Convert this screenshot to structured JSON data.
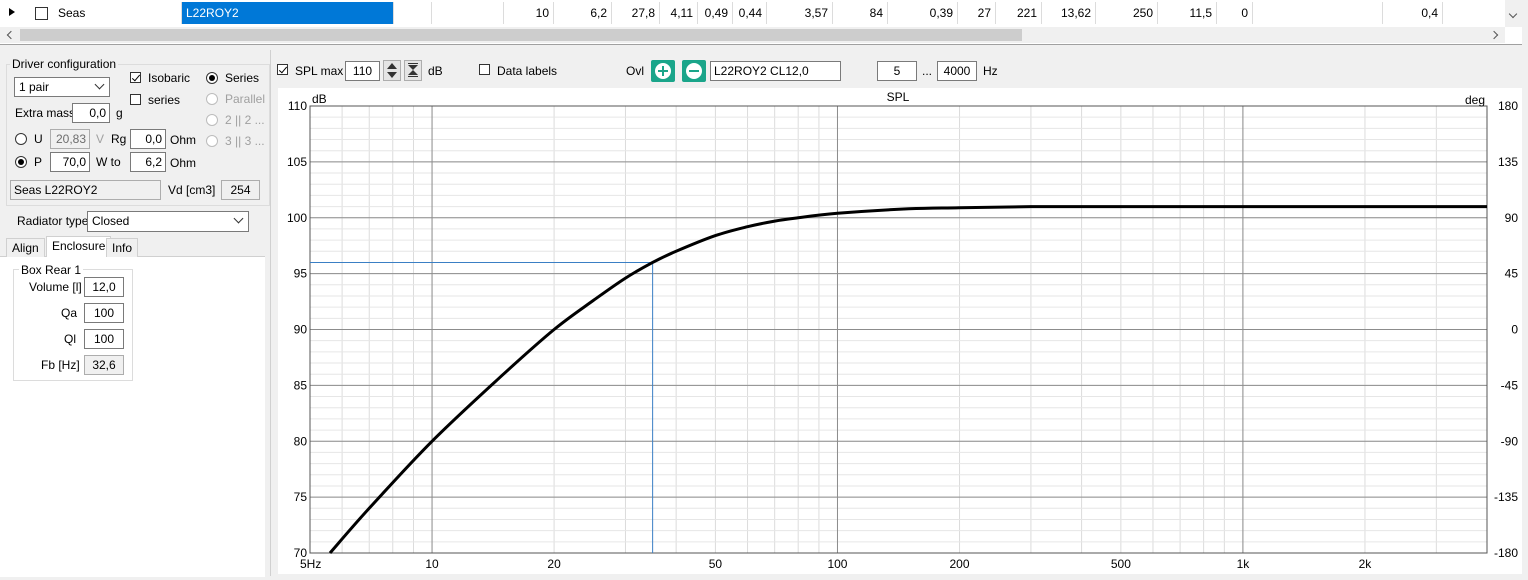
{
  "grid": {
    "brand": "Seas",
    "model": "L22ROY2",
    "values": [
      "10",
      "6,2",
      "27,8",
      "4,11",
      "0,49",
      "0,44",
      "3,57",
      "84",
      "0,39",
      "27",
      "221",
      "13,62",
      "250",
      "11,5",
      "0",
      "",
      "0,4"
    ]
  },
  "driver_config": {
    "title": "Driver configuration",
    "count_select": "1 pair",
    "isobaric_label": "Isobaric",
    "series_check_label": "series",
    "radio_series": "Series",
    "radio_parallel": "Parallel",
    "radio_2x2": "2 || 2 ...",
    "radio_3x3": "3 || 3 ...",
    "extra_mass_label": "Extra mass",
    "extra_mass_value": "0,0",
    "extra_mass_unit": "g",
    "u_label": "U",
    "u_value": "20,83",
    "u_unit": "V",
    "rg_label": "Rg",
    "rg_value": "0,0",
    "rg_unit": "Ohm",
    "p_label": "P",
    "p_value": "70,0",
    "wto_label": "W to",
    "wto_value": "6,2",
    "wto_unit": "Ohm",
    "driver_name": "Seas L22ROY2",
    "vd_label": "Vd [cm3]",
    "vd_value": "254"
  },
  "radiator": {
    "label": "Radiator type",
    "value": "Closed"
  },
  "tabs": [
    "Align",
    "Enclosure",
    "Info"
  ],
  "box": {
    "title": "Box Rear 1",
    "volume_label": "Volume [l]",
    "volume_value": "12,0",
    "qa_label": "Qa",
    "qa_value": "100",
    "ql_label": "Ql",
    "ql_value": "100",
    "fb_label": "Fb [Hz]",
    "fb_value": "32,6"
  },
  "toolbar": {
    "spl_max_label": "SPL max",
    "spl_max_value": "110",
    "db_unit": "dB",
    "data_labels": "Data labels",
    "ovl_label": "Ovl",
    "overlay_name": "L22ROY2 CL12,0",
    "range_from": "5",
    "range_sep": "...",
    "range_to": "4000",
    "hz_unit": "Hz"
  },
  "chart_data": {
    "type": "line",
    "title": "SPL",
    "ylabel": "dB",
    "y2label": "deg",
    "xscale": "log",
    "xlim": [
      5,
      4000
    ],
    "ylim": [
      70,
      110
    ],
    "y2lim": [
      -180,
      180
    ],
    "grid": true,
    "x_ticks": [
      {
        "v": 5,
        "label": "5Hz"
      },
      {
        "v": 10,
        "label": "10"
      },
      {
        "v": 20,
        "label": "20"
      },
      {
        "v": 50,
        "label": "50"
      },
      {
        "v": 100,
        "label": "100"
      },
      {
        "v": 200,
        "label": "200"
      },
      {
        "v": 500,
        "label": "500"
      },
      {
        "v": 1000,
        "label": "1k"
      },
      {
        "v": 2000,
        "label": "2k"
      }
    ],
    "y_ticks": [
      "110",
      "105",
      "100",
      "95",
      "90",
      "85",
      "80",
      "75",
      "70"
    ],
    "y2_ticks": [
      "180",
      "135",
      "90",
      "45",
      "0",
      "-45",
      "-90",
      "-135",
      "-180"
    ],
    "series": [
      {
        "color": "#000000",
        "x": [
          5.6,
          7,
          10,
          15,
          20,
          25,
          30,
          35,
          40,
          50,
          60,
          70,
          80,
          100,
          150,
          200,
          300,
          500,
          1000,
          2000,
          4000
        ],
        "y": [
          70,
          74,
          80,
          86,
          90,
          92.6,
          94.6,
          96,
          97,
          98.4,
          99.2,
          99.7,
          100,
          100.4,
          100.8,
          100.9,
          101,
          101,
          101,
          101,
          101
        ]
      }
    ],
    "marker": {
      "x": 35,
      "y": 96,
      "color": "#3a7fc4"
    }
  }
}
